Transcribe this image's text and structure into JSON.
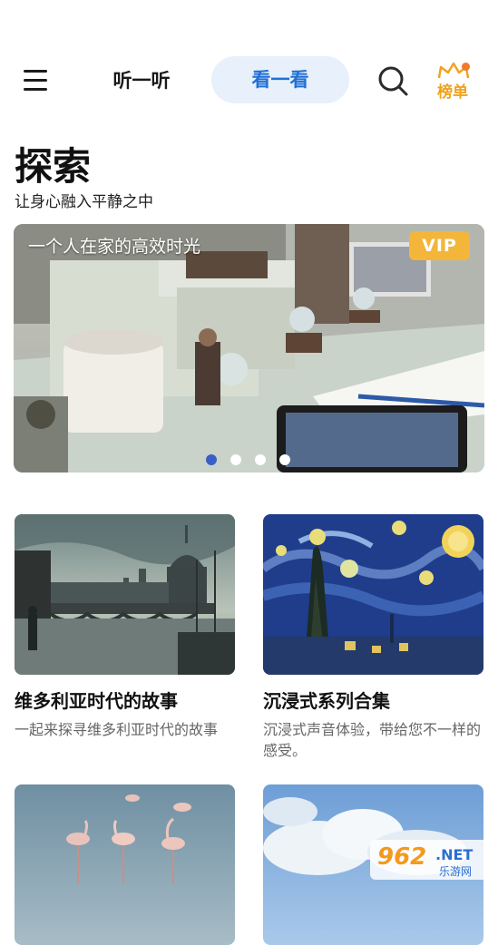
{
  "header": {
    "tab_listen": "听一听",
    "tab_watch": "看一看",
    "rank_label": "榜单"
  },
  "page": {
    "title": "探索",
    "subtitle": "让身心融入平静之中"
  },
  "banner": {
    "caption": "一个人在家的高效时光",
    "badge": "VIP",
    "slides_count": 4,
    "active_slide": 1
  },
  "cards": [
    {
      "title": "维多利亚时代的故事",
      "desc": "一起来探寻维多利亚时代的故事"
    },
    {
      "title": "沉浸式系列合集",
      "desc": "沉浸式声音体验，带给您不一样的感受。"
    },
    {
      "title": "",
      "desc": ""
    },
    {
      "title": "",
      "desc": ""
    }
  ],
  "watermark": {
    "number": "962",
    "suffix": ".NET",
    "site": "乐游网"
  },
  "colors": {
    "accent": "#1f6fd6",
    "tab_bg": "#e7f0fb",
    "rank": "#f0a21a",
    "vip": "#f3b63a",
    "dot_active": "#3a5fc9"
  }
}
